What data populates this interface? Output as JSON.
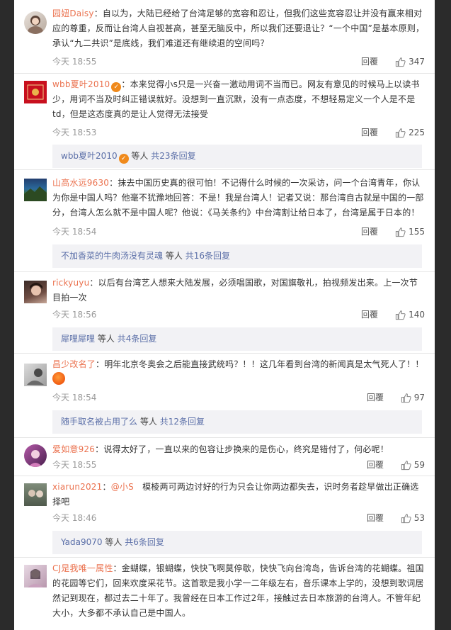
{
  "labels": {
    "reply": "回覆",
    "sub_mid": "等人",
    "sub_count_prefix": "共",
    "sub_count_suffix": "条回复"
  },
  "comments": [
    {
      "user": "园妞Daisy",
      "sep": "：",
      "text": "自以为，大陆已经给了台湾足够的宽容和忍让，但我们这些宽容忍让并没有赢来相对应的尊重，反而让台湾人自视甚高，甚至无脑反中，所以我们还要退让？“一个中国”是基本原则，承认“九二共识”是底线，我们难道还有继续退的空间吗？",
      "time": "今天 18:55",
      "likes": "347",
      "avatar_icon": "avatar-icon"
    },
    {
      "user": "wbb夏叶2010",
      "verified": true,
      "sep": "：",
      "text": "本来觉得小s只是一兴奋一激动用词不当而已。网友有意见的时候马上以读书少，用词不当及时纠正错误就好。没想到一直沉默，没有一点态度，不想轻易定义一个人是不是td，但是这态度真的是让人觉得无法接受",
      "time": "今天 18:53",
      "likes": "225",
      "sub": {
        "user": "wbb夏叶2010",
        "verified": true,
        "count": "23"
      }
    },
    {
      "user": "山高水远9630",
      "sep": "：",
      "text": "抹去中国历史真的很可怕！不记得什么时候的一次采访，问一个台湾青年，你认为你是中国人吗？他毫不犹豫地回答：不是！我是台湾人！记者又说：那台湾自古就是中国的一部分，台湾人怎么就不是中国人呢？他说：《马关条约》中台湾割让给日本了，台湾是属于日本的！",
      "time": "今天 18:54",
      "likes": "155",
      "sub": {
        "user": "不加香菜的牛肉汤没有灵魂",
        "count": "16"
      }
    },
    {
      "user": "rickyuyu",
      "sep": "：",
      "text": "以后有台湾艺人想来大陆发展，必须唱国歌，对国旗敬礼，拍视频发出来。上一次节目拍一次",
      "time": "今天 18:56",
      "likes": "140",
      "sub": {
        "user": "犀哩犀哩",
        "count": "4"
      }
    },
    {
      "user": "昌少改名了",
      "sep": "：",
      "text": "明年北京冬奥会之后能直接武统吗？！！这几年看到台湾的新闻真是太气死人了！！",
      "emoji": "angry-emoji-icon",
      "time": "今天 18:54",
      "likes": "97",
      "sub": {
        "user": "随手取名被占用了么",
        "count": "12"
      }
    },
    {
      "user": "爱如意926",
      "sep": "：",
      "text": "说得太好了，一直以来的包容让步换来的是伤心，终究是错付了，何必呢！",
      "time": "今天 18:55",
      "likes": "59"
    },
    {
      "user": "xiarun2021",
      "sep": "：",
      "mention": "@小S",
      "text": "　模棱两可两边讨好的行为只会让你两边都失去，识时务者趁早做出正确选择吧",
      "time": "今天 18:46",
      "likes": "53",
      "sub": {
        "user": "Yada9070",
        "count": "6"
      }
    },
    {
      "user": "CJ是我唯一属性",
      "sep": "：",
      "text": "金蝴蝶，银蝴蝶，快快飞啊莫停歇，快快飞向台湾岛，告诉台湾的花蝴蝶。祖国的花园等它们，回来欢度采花节。这首歌是我小学一二年级左右，音乐课本上学的，没想到歌词居然记到现在，都过去二十年了。我曾经在日本工作过2年，接触过去日本旅游的台湾人。不管年纪大小，大多都不承认自己是中国人。"
    }
  ]
}
